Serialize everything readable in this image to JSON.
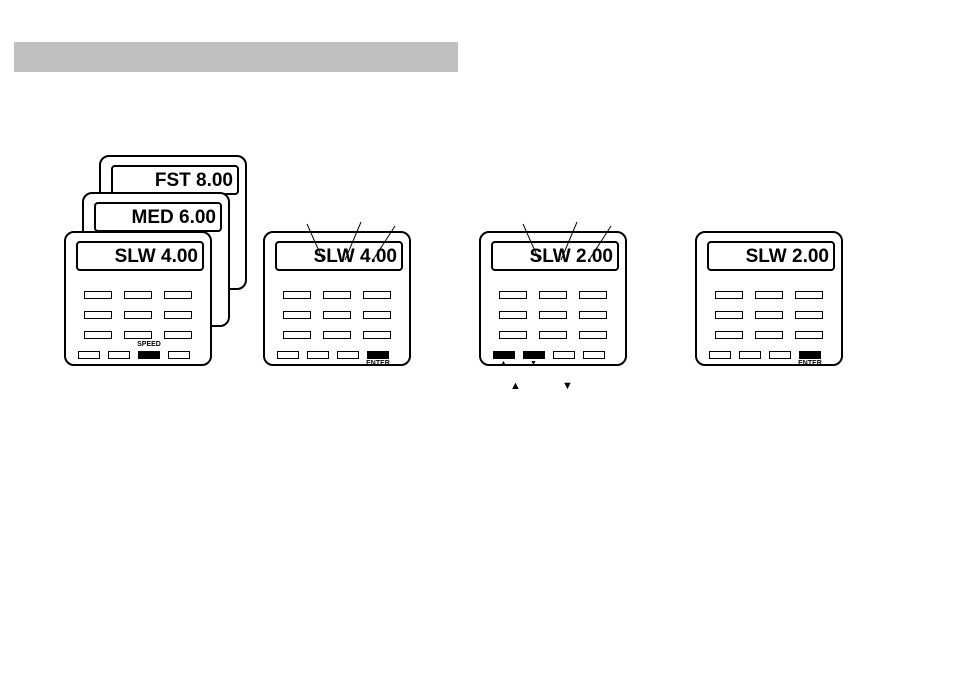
{
  "header_bar": "",
  "devices": {
    "stack": {
      "back": {
        "text": "FST  8.00"
      },
      "mid": {
        "text": "MED 6.00"
      },
      "front": {
        "text": "SLW 4.00",
        "highlighted_label": "SPEED"
      }
    },
    "d2": {
      "text": "SLW 4.00",
      "highlighted_label": "ENTER"
    },
    "d3": {
      "text": "SLW 2.00"
    },
    "d4": {
      "text": "SLW 2.00",
      "highlighted_label": "ENTER"
    }
  },
  "arrows_label": {
    "up": "▲",
    "down": "▼"
  }
}
